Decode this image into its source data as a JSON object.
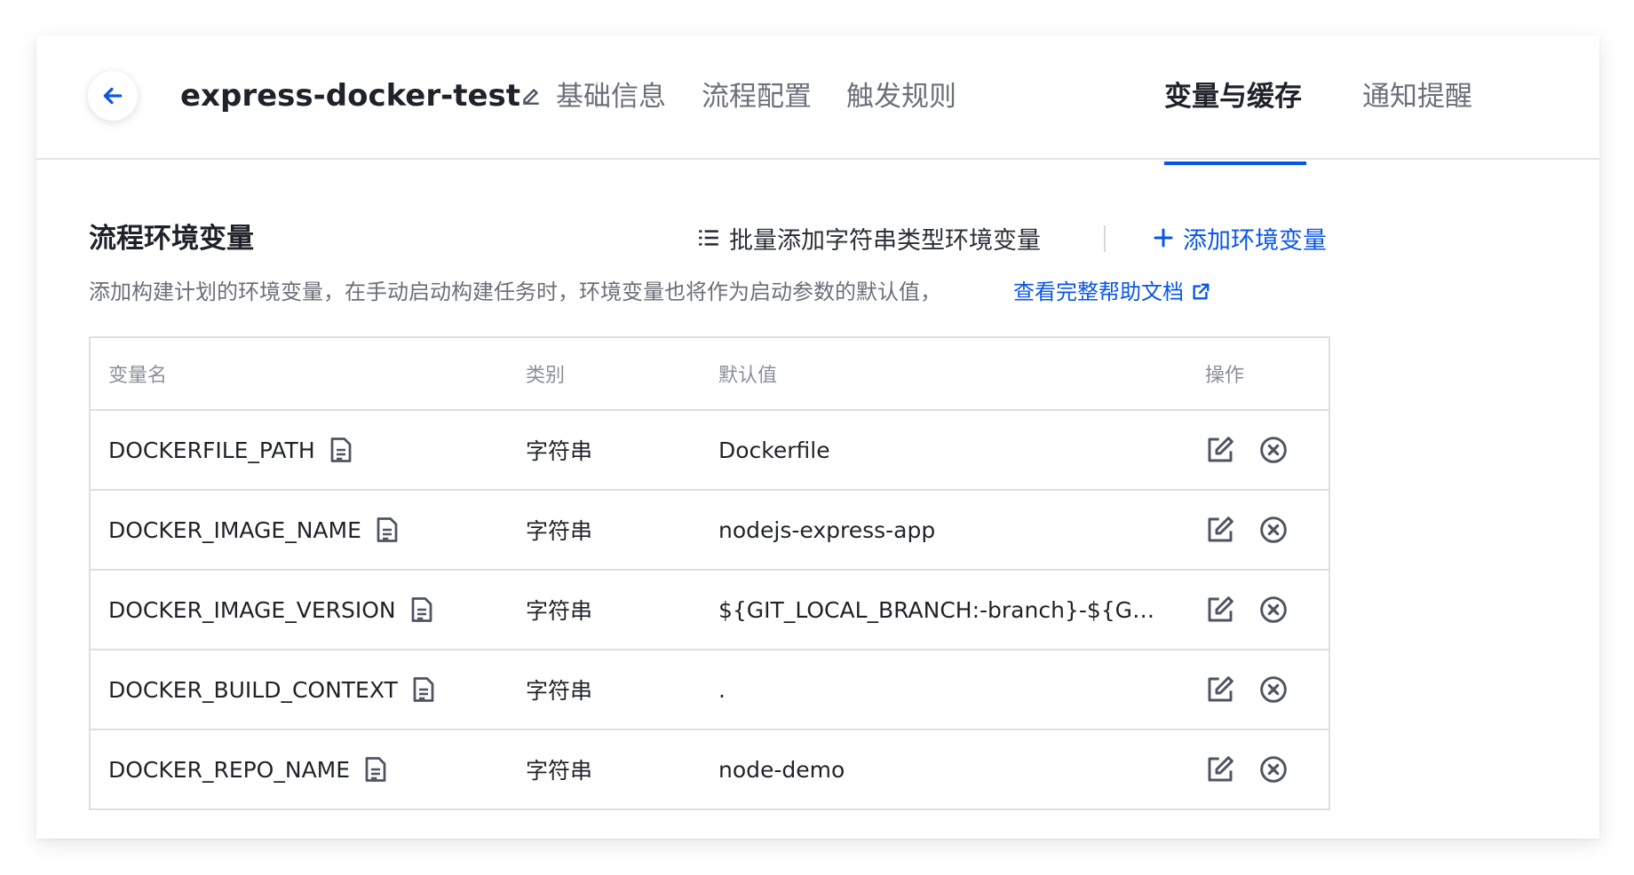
{
  "header": {
    "title": "express-docker-test",
    "tabs": [
      {
        "label": "基础信息",
        "active": false
      },
      {
        "label": "流程配置",
        "active": false
      },
      {
        "label": "触发规则",
        "active": false
      },
      {
        "label": "变量与缓存",
        "active": true
      },
      {
        "label": "通知提醒",
        "active": false
      }
    ]
  },
  "section": {
    "title": "流程环境变量",
    "bulk_add_label": "批量添加字符串类型环境变量",
    "add_label": "添加环境变量",
    "description": "添加构建计划的环境变量，在手动启动构建任务时，环境变量也将作为启动参数的默认值，",
    "help_link": "查看完整帮助文档"
  },
  "table": {
    "columns": [
      "变量名",
      "类别",
      "默认值",
      "操作"
    ],
    "rows": [
      {
        "name": "DOCKERFILE_PATH",
        "type": "字符串",
        "default": "Dockerfile"
      },
      {
        "name": "DOCKER_IMAGE_NAME",
        "type": "字符串",
        "default": "nodejs-express-app"
      },
      {
        "name": "DOCKER_IMAGE_VERSION",
        "type": "字符串",
        "default": "${GIT_LOCAL_BRANCH:-branch}-${GI..."
      },
      {
        "name": "DOCKER_BUILD_CONTEXT",
        "type": "字符串",
        "default": "."
      },
      {
        "name": "DOCKER_REPO_NAME",
        "type": "字符串",
        "default": "node-demo"
      }
    ]
  },
  "colors": {
    "accent": "#0a56e6",
    "text": "#1f2329",
    "muted": "#6b7079",
    "border": "#dcdfe4",
    "icon": "#4e5561"
  }
}
